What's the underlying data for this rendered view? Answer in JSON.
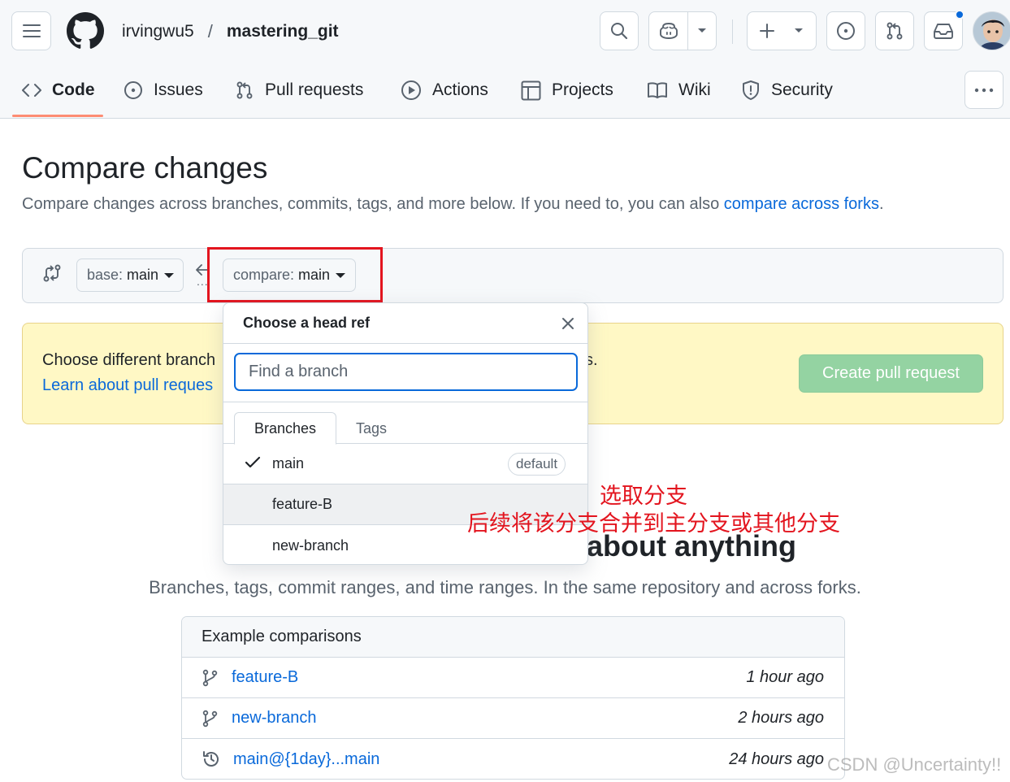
{
  "header": {
    "owner": "irvingwu5",
    "separator": "/",
    "repo": "mastering_git"
  },
  "repo_nav": {
    "items": [
      {
        "label": "Code",
        "icon": "code-icon",
        "active": true
      },
      {
        "label": "Issues",
        "icon": "issue-opened-icon"
      },
      {
        "label": "Pull requests",
        "icon": "git-pull-request-icon"
      },
      {
        "label": "Actions",
        "icon": "play-icon"
      },
      {
        "label": "Projects",
        "icon": "table-icon"
      },
      {
        "label": "Wiki",
        "icon": "book-icon"
      },
      {
        "label": "Security",
        "icon": "shield-icon"
      }
    ]
  },
  "page": {
    "title": "Compare changes",
    "subtitle": "Compare changes across branches, commits, tags, and more below. If you need to, you can also ",
    "subtitle_link": "compare across forks",
    "subtitle_end": "."
  },
  "range": {
    "base_label": "base:",
    "base_value": "main",
    "compare_label": "compare:",
    "compare_value": "main",
    "dots": "..."
  },
  "flash": {
    "line1": "Choose different branch",
    "line2": "Learn about pull reques",
    "tail": "s.",
    "button": "Create pull request"
  },
  "dropdown": {
    "title": "Choose a head ref",
    "filter_placeholder": "Find a branch",
    "tabs": [
      "Branches",
      "Tags"
    ],
    "items": [
      {
        "name": "main",
        "badge": "default",
        "selected": true
      },
      {
        "name": "feature-B"
      },
      {
        "name": "new-branch"
      }
    ]
  },
  "hero": {
    "heading": "about anything",
    "subheading": "Branches, tags, commit ranges, and time ranges. In the same repository and across forks."
  },
  "examples": {
    "header": "Example comparisons",
    "rows": [
      {
        "name": "feature-B",
        "time": "1 hour ago",
        "icon": "git-branch-icon"
      },
      {
        "name": "new-branch",
        "time": "2 hours ago",
        "icon": "git-branch-icon"
      },
      {
        "name": "main@{1day}...main",
        "time": "24 hours ago",
        "icon": "history-icon"
      }
    ]
  },
  "annotation": {
    "line1": "选取分支",
    "line2": "后续将该分支合并到主分支或其他分支"
  },
  "watermark": "CSDN @Uncertainty!!",
  "colors": {
    "accent_link": "#0969da",
    "nav_underline": "#fd8c73",
    "flash_bg": "#fff8c5",
    "create_pr_disabled": "#94d3a2",
    "annotation_red": "#e3141e",
    "notification_dot": "#0969da"
  }
}
